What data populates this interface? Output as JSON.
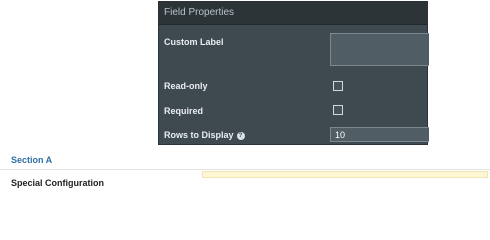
{
  "panel": {
    "title": "Field Properties",
    "fields": {
      "custom_label": {
        "label": "Custom Label",
        "value": ""
      },
      "read_only": {
        "label": "Read-only",
        "checked": false
      },
      "required": {
        "label": "Required",
        "checked": false
      },
      "rows_to_display": {
        "label": "Rows to Display",
        "value": "10",
        "help_icon": "help-icon"
      }
    }
  },
  "section": {
    "title": "Section A"
  },
  "config": {
    "label": "Special Configuration"
  },
  "colors": {
    "panel_bg": "#3f4a50",
    "panel_header_bg": "#2c3438",
    "section_link": "#2e6ea5",
    "highlight_bar": "#fff6d6"
  }
}
